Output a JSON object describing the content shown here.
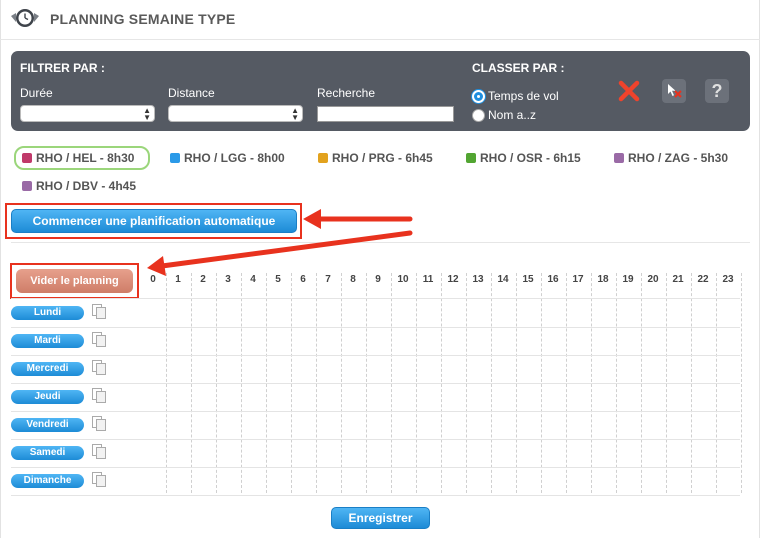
{
  "header": {
    "title": "PLANNING SEMAINE TYPE",
    "icon": "clock-icon"
  },
  "filters": {
    "title": "FILTRER PAR :",
    "duration_label": "Durée",
    "distance_label": "Distance",
    "search_label": "Recherche",
    "search_value": ""
  },
  "sort": {
    "title": "CLASSER PAR :",
    "options": [
      "Temps de vol",
      "Nom a..z"
    ],
    "selected": "Temps de vol"
  },
  "routes": [
    {
      "label": "RHO / HEL - 8h30",
      "color": "#c0396a"
    },
    {
      "label": "RHO / LGG - 8h00",
      "color": "#2b9ae8"
    },
    {
      "label": "RHO / PRG - 6h45",
      "color": "#e2a21e"
    },
    {
      "label": "RHO / OSR - 6h15",
      "color": "#52a532"
    },
    {
      "label": "RHO / ZAG - 5h30",
      "color": "#9a6aa6"
    },
    {
      "label": "RHO / DBV - 4h45",
      "color": "#9a6aa6"
    }
  ],
  "buttons": {
    "auto_plan": "Commencer une planification automatique",
    "clear": "Vider le planning",
    "save": "Enregistrer"
  },
  "hours": [
    "0",
    "1",
    "2",
    "3",
    "4",
    "5",
    "6",
    "7",
    "8",
    "9",
    "10",
    "11",
    "12",
    "13",
    "14",
    "15",
    "16",
    "17",
    "18",
    "19",
    "20",
    "21",
    "22",
    "23"
  ],
  "days": [
    "Lundi",
    "Mardi",
    "Mercredi",
    "Jeudi",
    "Vendredi",
    "Samedi",
    "Dimanche"
  ],
  "colors": {
    "accent": "#1d8bd6",
    "panel": "#555a63",
    "highlight": "#e8321e"
  }
}
